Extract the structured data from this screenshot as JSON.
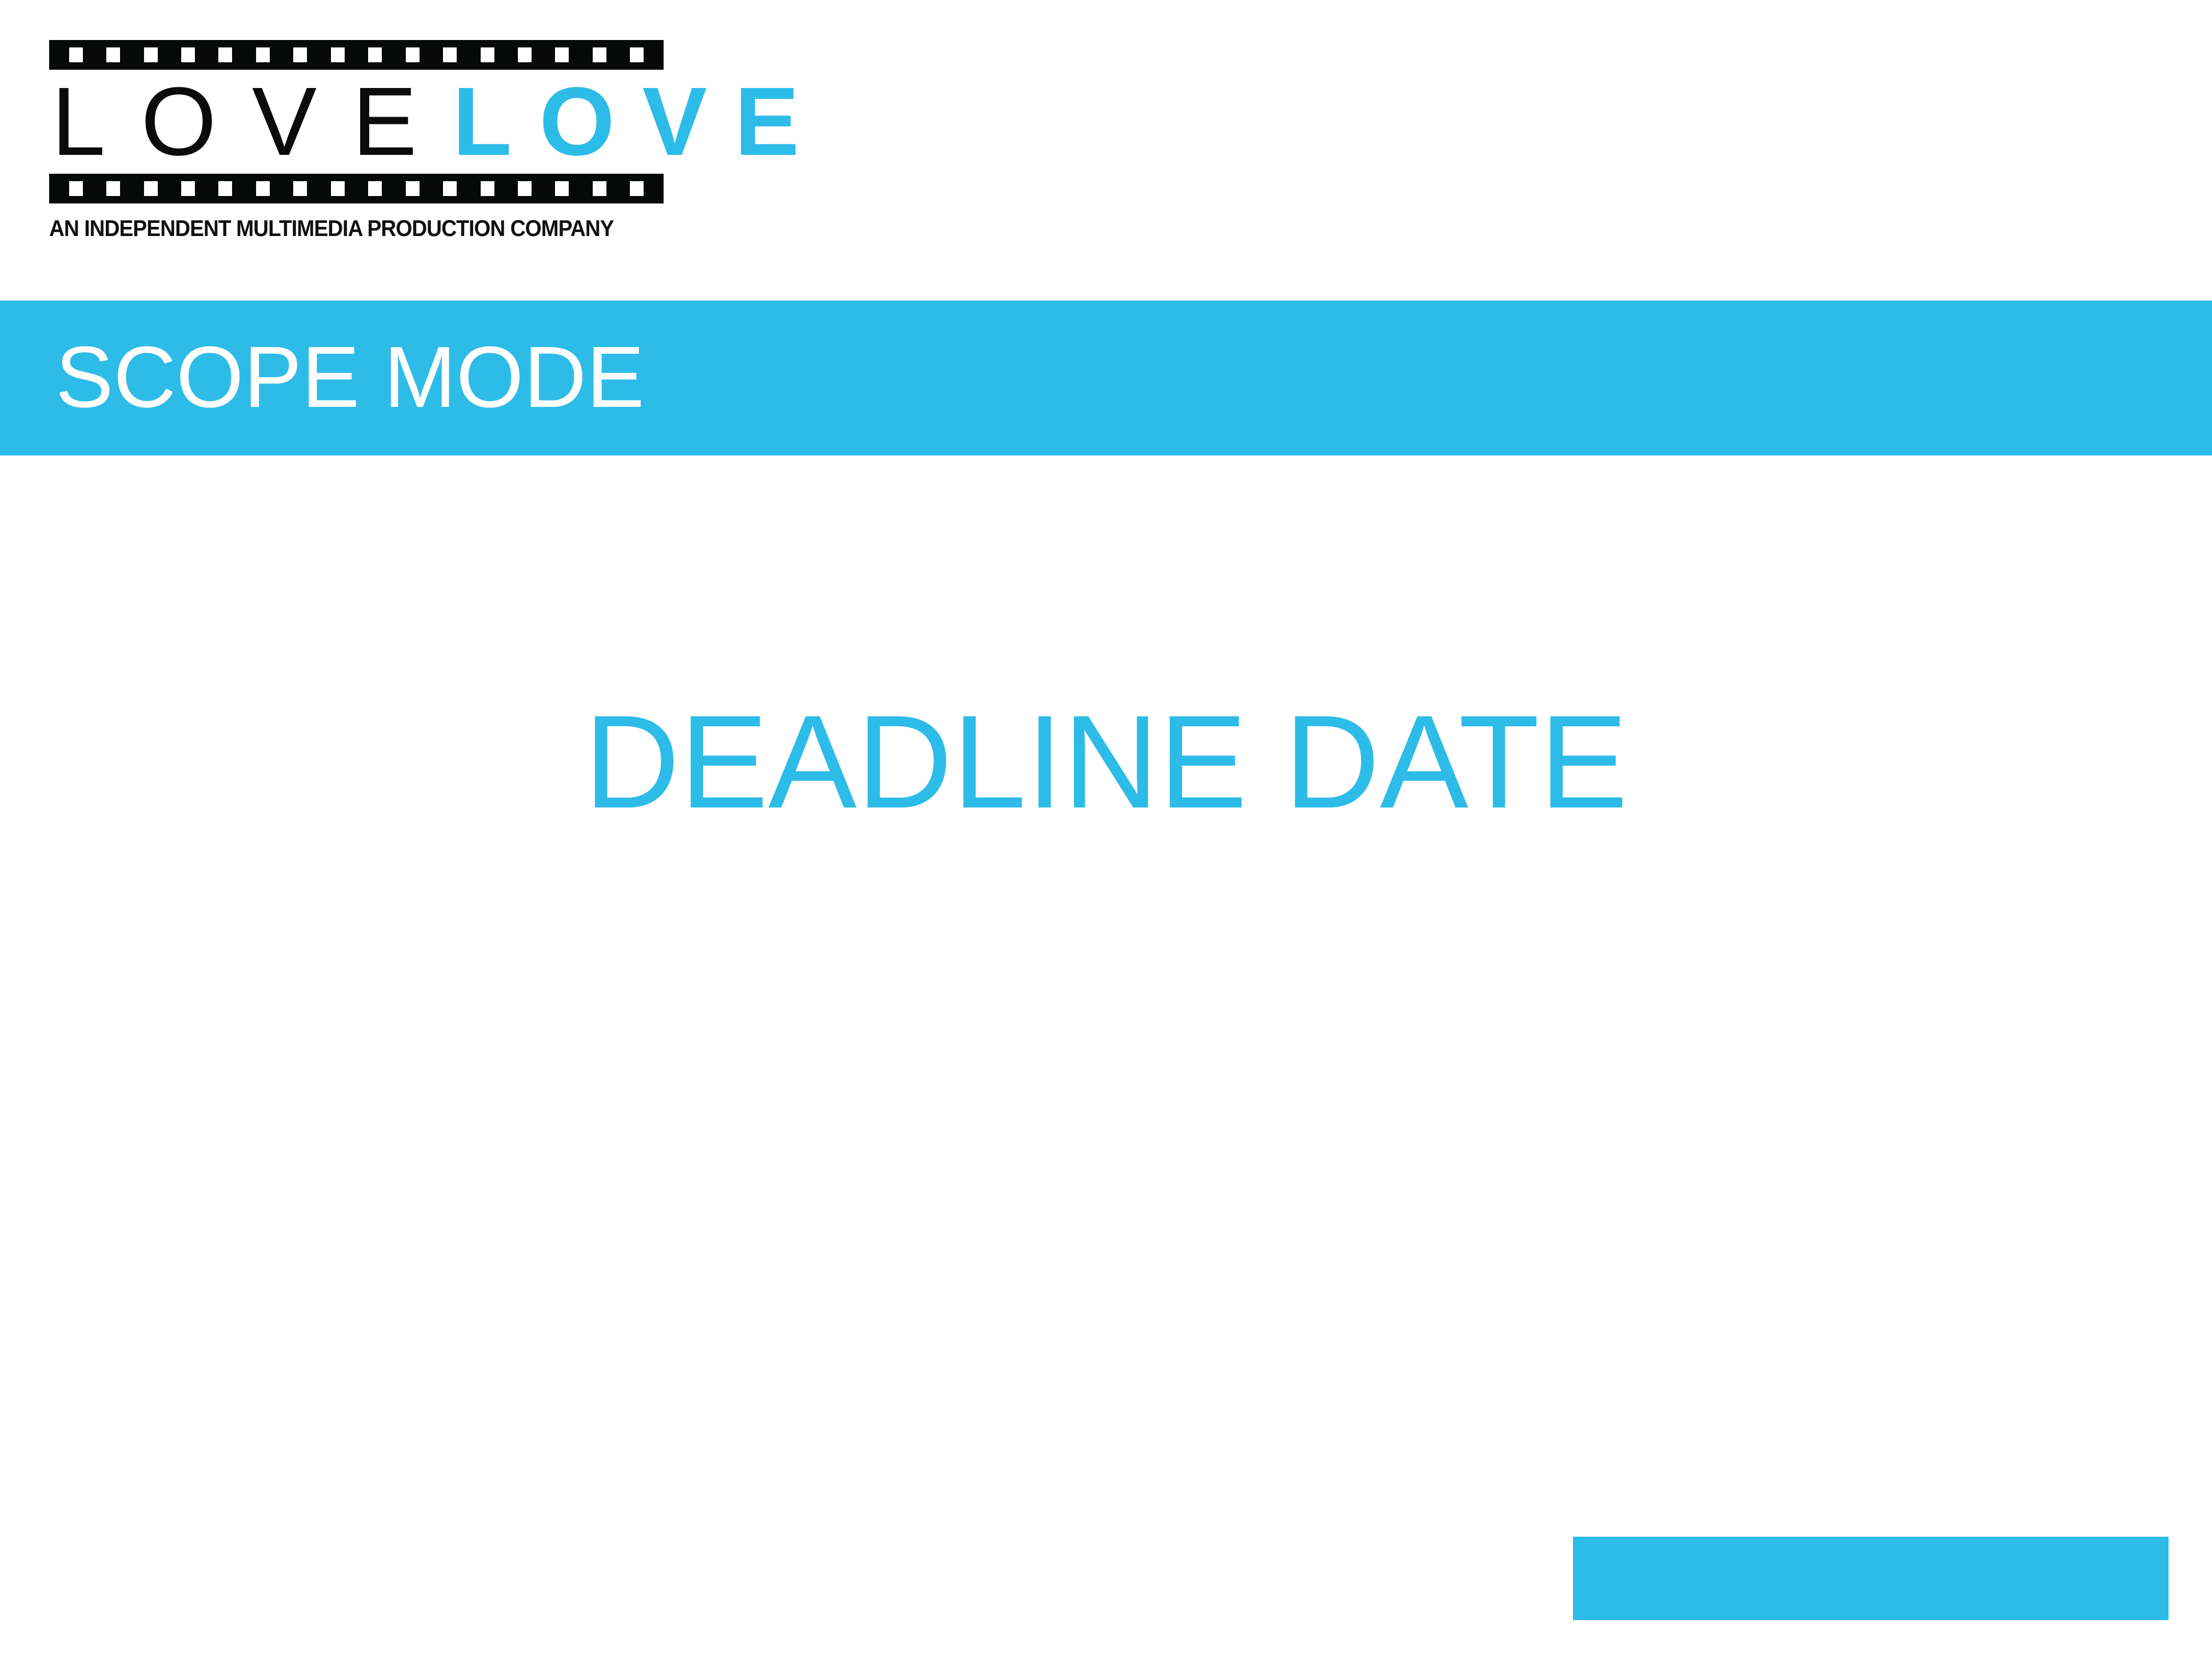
{
  "logo": {
    "word_dark": "LOVE",
    "word_blue": "LOVE",
    "tagline": "AN INDEPENDENT MULTIMEDIA PRODUCTION COMPANY"
  },
  "header": {
    "title": "SCOPE MODE"
  },
  "main": {
    "heading": "DEADLINE DATE"
  },
  "colors": {
    "accent": "#2dbce8",
    "dark": "#070808"
  }
}
